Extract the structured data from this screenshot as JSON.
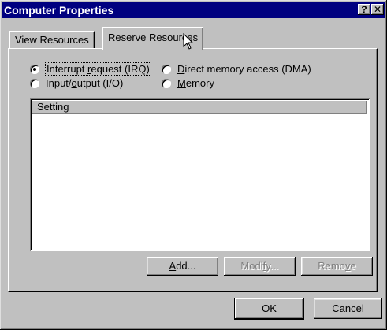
{
  "window": {
    "title": "Computer Properties",
    "help_label": "?",
    "close_label": "✕"
  },
  "tabs": [
    {
      "label": "View Resources",
      "selected": false
    },
    {
      "label": "Reserve Resources",
      "selected": true
    }
  ],
  "resource_types": [
    {
      "pre": "Interrupt ",
      "ul": "r",
      "post": "equest (IRQ)",
      "checked": true
    },
    {
      "pre": "",
      "ul": "D",
      "post": "irect memory access (DMA)",
      "checked": false
    },
    {
      "pre": "Input/",
      "ul": "o",
      "post": "utput (I/O)",
      "checked": false
    },
    {
      "pre": "",
      "ul": "M",
      "post": "emory",
      "checked": false
    }
  ],
  "list": {
    "column_header": "Setting",
    "rows": []
  },
  "buttons": {
    "add": {
      "ul": "A",
      "post": "dd...",
      "enabled": true
    },
    "modify": {
      "pre": "Modi",
      "ul": "f",
      "post": "y...",
      "enabled": false
    },
    "remove": {
      "pre": "Remo",
      "ul": "v",
      "post": "e",
      "enabled": false
    },
    "ok": "OK",
    "cancel": "Cancel"
  },
  "colors": {
    "title_bar": "#000080",
    "face": "#c0c0c0",
    "list_bg": "#ffffff",
    "disabled_text": "#808080"
  },
  "icons": {
    "cursor": "arrow-cursor-icon"
  }
}
